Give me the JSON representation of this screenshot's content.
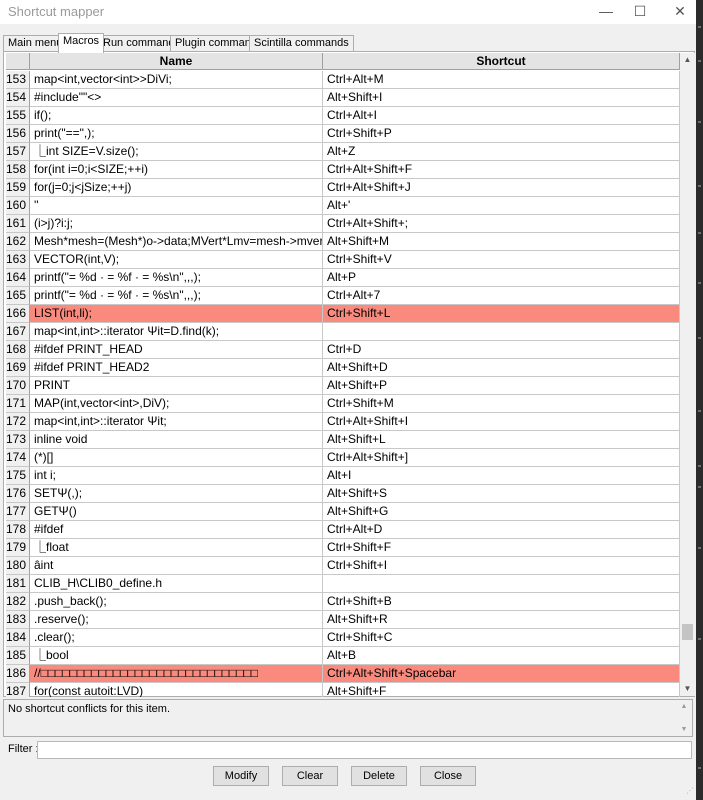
{
  "window": {
    "title": "Shortcut mapper",
    "minimize": "—",
    "maximize": "☐",
    "close": "✕"
  },
  "tabs": [
    {
      "label": "Main menu"
    },
    {
      "label": "Macros",
      "active": true
    },
    {
      "label": "Run commands"
    },
    {
      "label": "Plugin commands"
    },
    {
      "label": "Scintilla commands"
    }
  ],
  "table": {
    "headers": {
      "number": "",
      "name": "Name",
      "shortcut": "Shortcut"
    },
    "rows": [
      {
        "num": "153",
        "name": "map<int,vector<int>>DiVi;",
        "shortcut": "Ctrl+Alt+M"
      },
      {
        "num": "154",
        "name": "#include\"\"<>",
        "shortcut": "Alt+Shift+I"
      },
      {
        "num": "155",
        "name": "if();",
        "shortcut": "Ctrl+Alt+I"
      },
      {
        "num": "156",
        "name": "print(\"==\",);",
        "shortcut": "Ctrl+Shift+P"
      },
      {
        "num": "157",
        "name": "⎿int SIZE=V.size();",
        "shortcut": "Alt+Z"
      },
      {
        "num": "158",
        "name": "for(int i=0;i<SIZE;++i)",
        "shortcut": "Ctrl+Alt+Shift+F"
      },
      {
        "num": "159",
        "name": "for(j=0;j<jSize;++j)",
        "shortcut": "Ctrl+Alt+Shift+J"
      },
      {
        "num": "160",
        "name": "''",
        "shortcut": "Alt+'"
      },
      {
        "num": "161",
        "name": "(i>j)?i:j;",
        "shortcut": "Ctrl+Alt+Shift+;"
      },
      {
        "num": "162",
        "name": "Mesh*mesh=(Mesh*)o->data;MVert*Lmv=mesh->mvert;",
        "shortcut": "Alt+Shift+M"
      },
      {
        "num": "163",
        "name": "VECTOR(int,V);",
        "shortcut": "Ctrl+Shift+V"
      },
      {
        "num": "164",
        "name": "printf(\"= %d · = %f · = %s\\n\",,,);",
        "shortcut": "Alt+P"
      },
      {
        "num": "165",
        "name": "printf(\"= %d · = %f · = %s\\n\",,,);",
        "shortcut": "Ctrl+Alt+7"
      },
      {
        "num": "166",
        "name": "LIST(int,li);",
        "shortcut": "Ctrl+Shift+L",
        "selected": true
      },
      {
        "num": "167",
        "name": "map<int,int>::iterator Ψit=D.find(k);",
        "shortcut": ""
      },
      {
        "num": "168",
        "name": "#ifdef PRINT_HEAD",
        "shortcut": "Ctrl+D"
      },
      {
        "num": "169",
        "name": "#ifdef PRINT_HEAD2",
        "shortcut": "Alt+Shift+D"
      },
      {
        "num": "170",
        "name": "PRINT",
        "shortcut": "Alt+Shift+P"
      },
      {
        "num": "171",
        "name": "MAP(int,vector<int>,DiV);",
        "shortcut": "Ctrl+Shift+M"
      },
      {
        "num": "172",
        "name": "map<int,int>::iterator Ψit;",
        "shortcut": "Ctrl+Alt+Shift+I"
      },
      {
        "num": "173",
        "name": "inline void",
        "shortcut": "Alt+Shift+L"
      },
      {
        "num": "174",
        "name": "(*)[]",
        "shortcut": "Ctrl+Alt+Shift+]"
      },
      {
        "num": "175",
        "name": "int i;",
        "shortcut": "Alt+I"
      },
      {
        "num": "176",
        "name": "SETΨ(,);",
        "shortcut": "Alt+Shift+S"
      },
      {
        "num": "177",
        "name": "GETΨ()",
        "shortcut": "Alt+Shift+G"
      },
      {
        "num": "178",
        "name": "#ifdef",
        "shortcut": "Ctrl+Alt+D"
      },
      {
        "num": "179",
        "name": "⎿float",
        "shortcut": "Ctrl+Shift+F"
      },
      {
        "num": "180",
        "name": "âint",
        "shortcut": "Ctrl+Shift+I"
      },
      {
        "num": "181",
        "name": "CLIB_H\\CLIB0_define.h",
        "shortcut": ""
      },
      {
        "num": "182",
        "name": ".push_back();",
        "shortcut": "Ctrl+Shift+B"
      },
      {
        "num": "183",
        "name": ".reserve();",
        "shortcut": "Alt+Shift+R"
      },
      {
        "num": "184",
        "name": ".clear();",
        "shortcut": "Ctrl+Shift+C"
      },
      {
        "num": "185",
        "name": "⎿bool",
        "shortcut": "Alt+B"
      },
      {
        "num": "186",
        "name": "//□□□□□□□□□□□□□□□□□□□□□□□□□□□□□□",
        "shortcut": "Ctrl+Alt+Shift+Spacebar",
        "selected": true
      },
      {
        "num": "187",
        "name": "for(const autoit:LVD)",
        "shortcut": "Alt+Shift+F"
      }
    ]
  },
  "scrollbar": {
    "up": "▲",
    "down": "▼",
    "position_fraction": 0.93
  },
  "conflict_message": "No shortcut conflicts for this item.",
  "conflict_scroll": {
    "up": "▲",
    "down": "▼"
  },
  "filter": {
    "label": "Filter :",
    "value": ""
  },
  "buttons": {
    "modify": "Modify",
    "clear": "Clear",
    "delete": "Delete",
    "close": "Close"
  },
  "resize_grip": "⋰"
}
